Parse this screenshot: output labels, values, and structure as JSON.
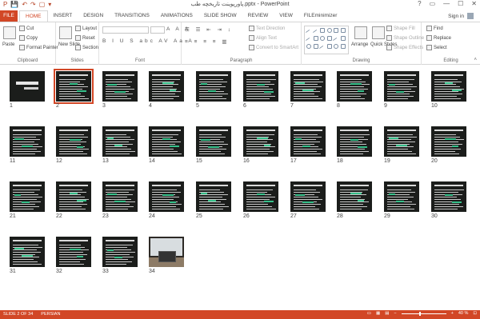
{
  "window": {
    "title": "پاورپوینت تاریخچه طب.pptx - PowerPoint",
    "controls": [
      "?",
      "▭",
      "—",
      "☐",
      "✕"
    ]
  },
  "qat": [
    "P",
    "💾",
    "↶",
    "↷",
    "▢",
    "▾"
  ],
  "tabs": [
    "FILE",
    "HOME",
    "INSERT",
    "DESIGN",
    "TRANSITIONS",
    "ANIMATIONS",
    "SLIDE SHOW",
    "REVIEW",
    "VIEW",
    "FILEminimizer"
  ],
  "active_tab": "HOME",
  "signin": "Sign in",
  "ribbon": {
    "clipboard": {
      "label": "Clipboard",
      "paste": "Paste",
      "cut": "Cut",
      "copy": "Copy",
      "format_painter": "Format Painter"
    },
    "slides": {
      "label": "Slides",
      "new_slide": "New Slide",
      "layout": "Layout",
      "reset": "Reset",
      "section": "Section"
    },
    "font": {
      "label": "Font",
      "format_row1": "A A A",
      "format_row2": "B I U S abc AV Aa A"
    },
    "paragraph": {
      "label": "Paragraph",
      "text_direction": "Text Direction",
      "align_text": "Align Text",
      "convert_smartart": "Convert to SmartArt"
    },
    "drawing": {
      "label": "Drawing",
      "arrange": "Arrange",
      "quick_styles": "Quick Styles",
      "shape_fill": "Shape Fill",
      "shape_outline": "Shape Outline",
      "shape_effects": "Shape Effects"
    },
    "editing": {
      "label": "Editing",
      "find": "Find",
      "replace": "Replace",
      "select": "Select"
    }
  },
  "slides": {
    "selected": 2,
    "numbers": [
      "1",
      "2",
      "3",
      "4",
      "5",
      "6",
      "7",
      "8",
      "9",
      "10",
      "11",
      "12",
      "13",
      "14",
      "15",
      "16",
      "17",
      "18",
      "19",
      "20",
      "21",
      "22",
      "23",
      "24",
      "25",
      "26",
      "27",
      "28",
      "29",
      "30",
      "31",
      "32",
      "33",
      "34"
    ]
  },
  "status": {
    "slide_info": "SLIDE 2 OF 34",
    "language": "PERSIAN",
    "zoom": "40 %"
  }
}
